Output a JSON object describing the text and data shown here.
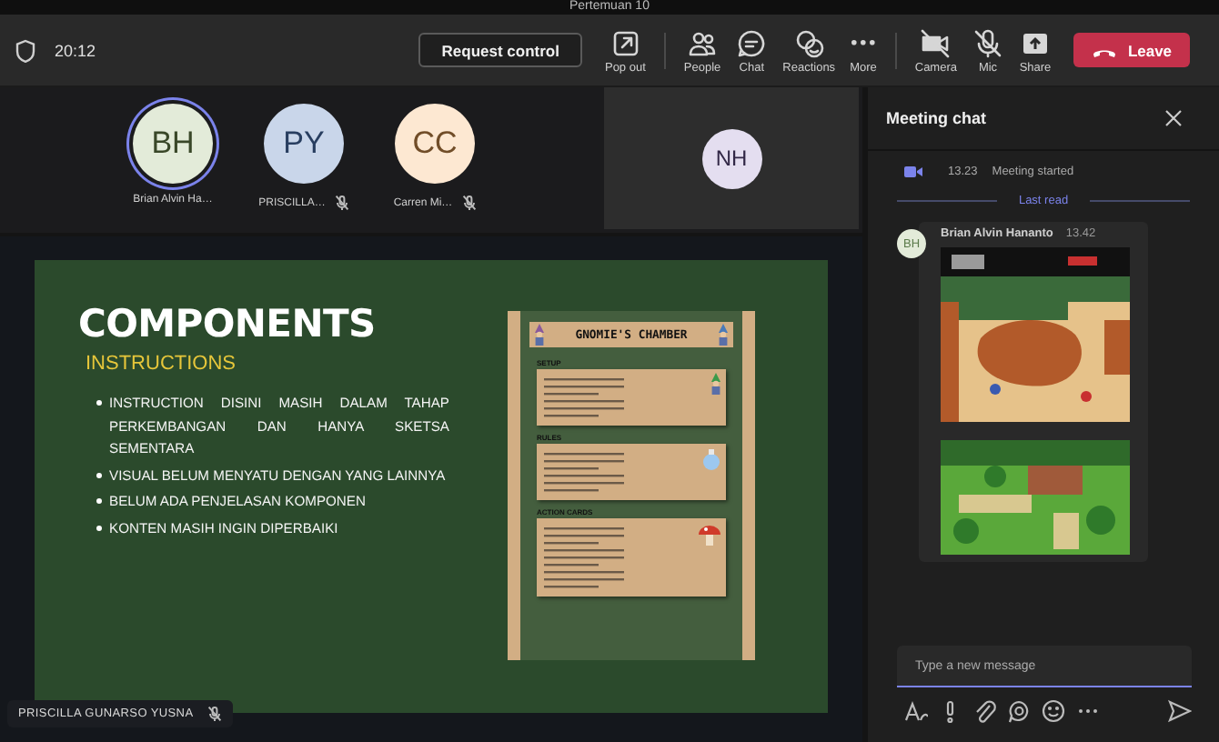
{
  "window": {
    "title": "Pertemuan 10"
  },
  "toolbar": {
    "time": "20:12",
    "request_button": "Request control",
    "actions": [
      {
        "label": "Pop out",
        "kind": "popout"
      },
      {
        "label": "People",
        "kind": "people"
      },
      {
        "label": "Chat",
        "kind": "chat"
      },
      {
        "label": "Reactions",
        "kind": "reactions"
      },
      {
        "label": "More",
        "kind": "more"
      },
      {
        "label": "Camera",
        "kind": "camera"
      },
      {
        "label": "Mic",
        "kind": "mic"
      },
      {
        "label": "Share",
        "kind": "share"
      }
    ],
    "leave_button": "Leave"
  },
  "participants": [
    {
      "initials": "BH",
      "name": "Brian Alvin Ha…",
      "muted": false,
      "speaking": true,
      "color": "#e3ebd9"
    },
    {
      "initials": "PY",
      "name": "PRISCILLA…",
      "muted": true,
      "speaking": false,
      "color": "#c9d6ea"
    },
    {
      "initials": "CC",
      "name": "Carren Mi…",
      "muted": true,
      "speaking": false,
      "color": "#fde8d2"
    }
  ],
  "spotlight_tile": {
    "initials": "NH",
    "color": "#e4def0"
  },
  "shared_screen": {
    "slide": {
      "title": "COMPONENTS",
      "subtitle": "INSTRUCTIONS",
      "bullets": [
        "INSTRUCTION DISINI MASIH DALAM TAHAP PERKEMBANGAN DAN HANYA SKETSA SEMENTARA",
        "VISUAL BELUM MENYATU DENGAN YANG LAINNYA",
        "BELUM ADA PENJELASAN KOMPONEN",
        "KONTEN MASIH INGIN DIPERBAIKI"
      ],
      "poster": {
        "title": "GNOMIE'S CHAMBER",
        "sections": [
          "SETUP",
          "RULES",
          "ACTION CARDS"
        ]
      }
    },
    "presenter": {
      "name": "PRISCILLA GUNARSO YUSNA",
      "muted": true
    }
  },
  "chat": {
    "title": "Meeting chat",
    "events": [
      {
        "time": "13.23",
        "text": "Meeting started"
      }
    ],
    "divider": "Last read",
    "messages": [
      {
        "initials": "BH",
        "author": "Brian Alvin Hananto",
        "time": "13.42"
      }
    ],
    "composer": {
      "placeholder": "Type a new message"
    },
    "composer_tools": [
      {
        "kind": "format"
      },
      {
        "kind": "priority"
      },
      {
        "kind": "attach"
      },
      {
        "kind": "loop"
      },
      {
        "kind": "emoji"
      },
      {
        "kind": "more"
      }
    ]
  }
}
